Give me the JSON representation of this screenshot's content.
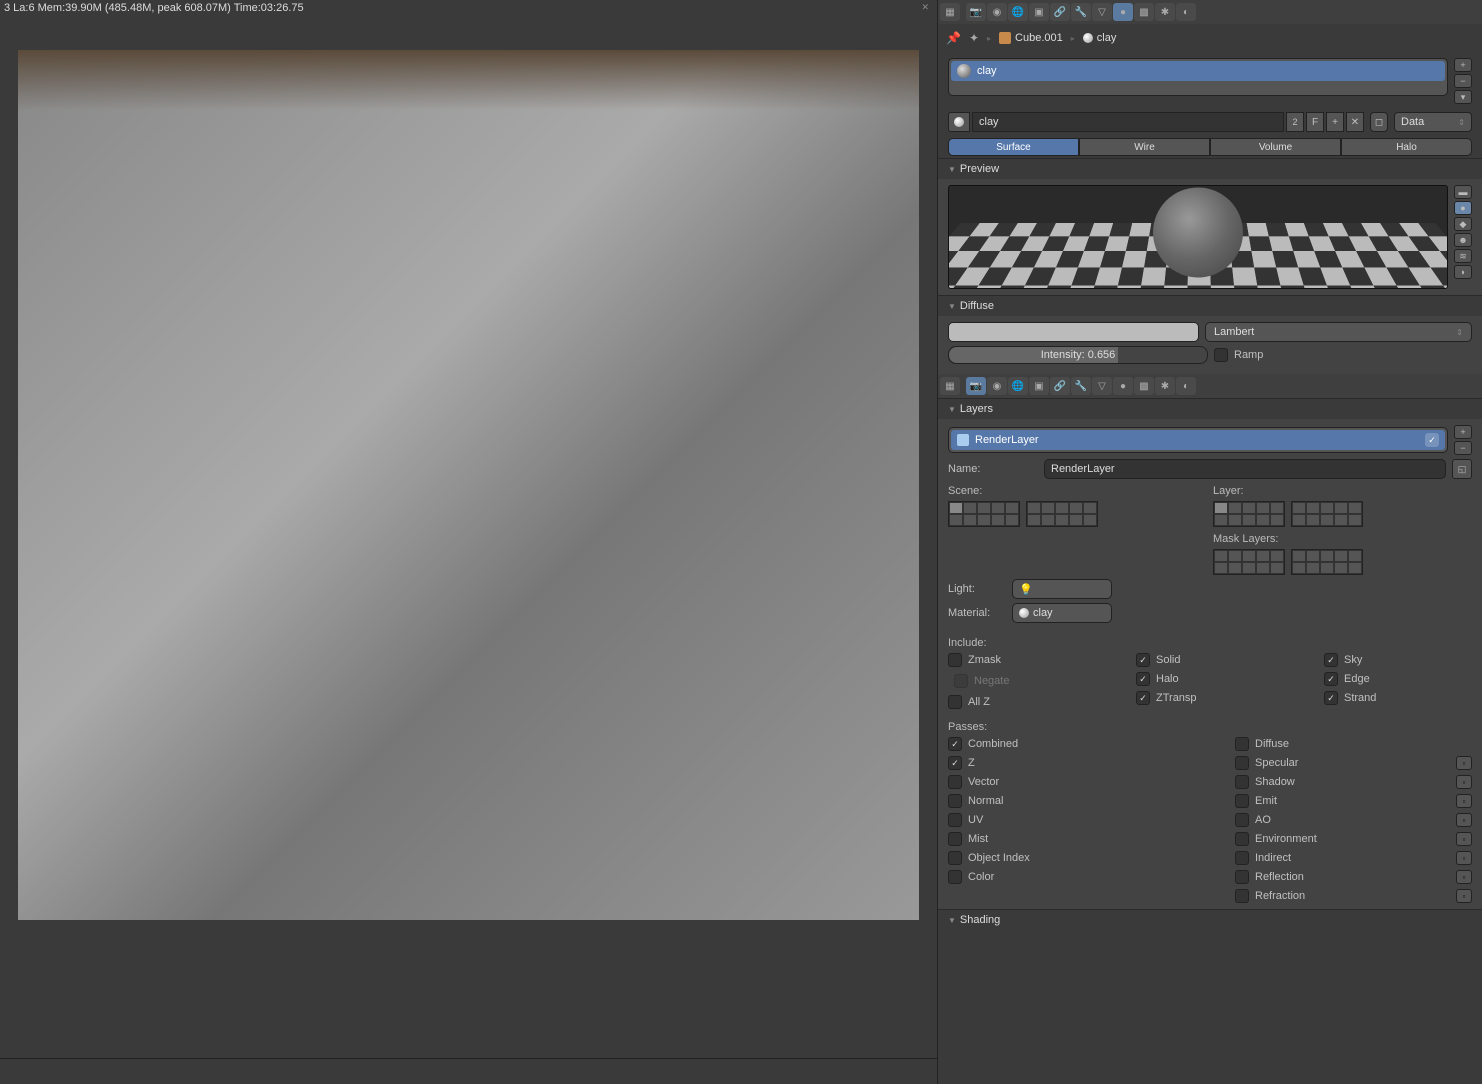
{
  "status_bar": "3 La:6 Mem:39.90M (485.48M, peak 608.07M) Time:03:26.75",
  "breadcrumb": {
    "object": "Cube.001",
    "material": "clay"
  },
  "material": {
    "slot_name": "clay",
    "name": "clay",
    "users": "2",
    "link_from": "Data",
    "tabs": {
      "surface": "Surface",
      "wire": "Wire",
      "volume": "Volume",
      "halo": "Halo"
    },
    "preview_label": "Preview",
    "diffuse": {
      "label": "Diffuse",
      "shader": "Lambert",
      "intensity_label": "Intensity: 0.656",
      "intensity_pct": 65.6,
      "ramp_label": "Ramp"
    }
  },
  "layers_panel": {
    "label": "Layers",
    "render_layer": "RenderLayer",
    "name_label": "Name:",
    "name_value": "RenderLayer",
    "scene_label": "Scene:",
    "layer_label": "Layer:",
    "mask_label": "Mask Layers:",
    "light_label": "Light:",
    "material_label": "Material:",
    "material_override": "clay",
    "include_label": "Include:",
    "include": {
      "zmask": "Zmask",
      "negate": "Negate",
      "allz": "All Z",
      "solid": "Solid",
      "halo": "Halo",
      "ztransp": "ZTransp",
      "sky": "Sky",
      "edge": "Edge",
      "strand": "Strand"
    },
    "passes_label": "Passes:",
    "passes": {
      "combined": "Combined",
      "z": "Z",
      "vector": "Vector",
      "normal": "Normal",
      "uv": "UV",
      "mist": "Mist",
      "objindex": "Object Index",
      "color": "Color",
      "diffuse": "Diffuse",
      "specular": "Specular",
      "shadow": "Shadow",
      "emit": "Emit",
      "ao": "AO",
      "environment": "Environment",
      "indirect": "Indirect",
      "reflection": "Reflection",
      "refraction": "Refraction"
    }
  },
  "shading_label": "Shading"
}
